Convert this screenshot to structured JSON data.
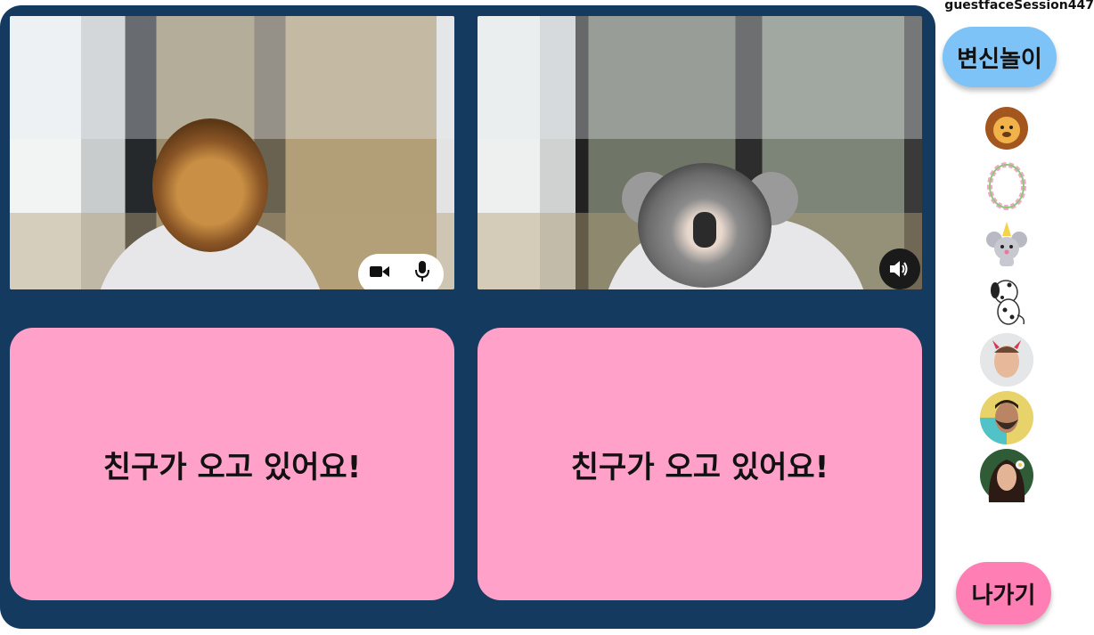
{
  "session": {
    "name": "guestfaceSession447"
  },
  "videos": [
    {
      "filter": "lion",
      "controls": [
        "video-camera-icon",
        "microphone-icon"
      ]
    },
    {
      "filter": "koala",
      "controls": [
        "volume-icon"
      ]
    }
  ],
  "waiting_tiles": [
    {
      "message": "친구가 오고 있어요!"
    },
    {
      "message": "친구가 오고 있어요!"
    }
  ],
  "sidebar": {
    "transform_button": "변신놀이",
    "filters": [
      {
        "icon": "lion-face-icon"
      },
      {
        "icon": "flower-crown-icon"
      },
      {
        "icon": "mouse-party-hat-icon"
      },
      {
        "icon": "dalmatian-dog-icon"
      },
      {
        "icon": "devil-horns-man-avatar"
      },
      {
        "icon": "bearded-man-avatar"
      },
      {
        "icon": "woman-flower-avatar"
      }
    ],
    "leave_button": "나가기"
  },
  "colors": {
    "stage": "#143a60",
    "waiting_tile": "#ffa1c8",
    "transform_button": "#7ec3f7",
    "leave_button": "#ff7fb5"
  }
}
